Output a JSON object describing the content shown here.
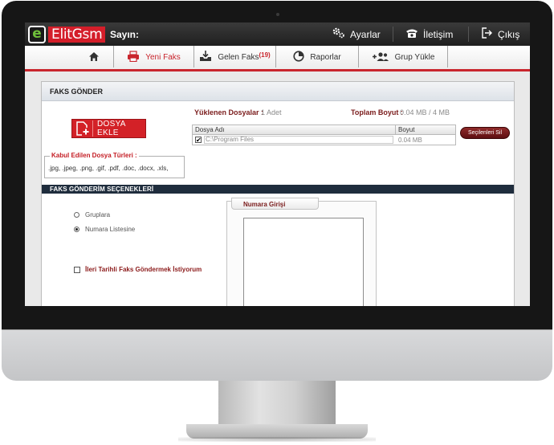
{
  "brand": {
    "logo_letter": "e",
    "logo_name": "ElitGsm",
    "greeting": "Sayın:"
  },
  "top_nav": [
    {
      "label": "Ayarlar",
      "icon": "gears-icon"
    },
    {
      "label": "İletişim",
      "icon": "phone-icon"
    },
    {
      "label": "Çıkış",
      "icon": "logout-icon"
    }
  ],
  "sub_nav": {
    "home_icon": "home-icon",
    "items": [
      {
        "label": "Yeni Faks",
        "icon": "printer-icon",
        "active": true
      },
      {
        "label": "Gelen Faks",
        "badge": "(19)",
        "icon": "inbox-download-icon"
      },
      {
        "label": "Raporlar",
        "icon": "pie-chart-icon"
      },
      {
        "label": "Grup Yükle",
        "icon": "group-add-icon"
      }
    ]
  },
  "panel": {
    "title": "FAKS GÖNDER",
    "uploaded_label": "Yüklenen Dosyalar :",
    "uploaded_value": "1 Adet",
    "total_size_label": "Toplam Boyut :",
    "total_size_value": "0.04 MB / 4 MB",
    "add_file_button": "DOSYA EKLE",
    "accepted_types_label": "Kabul Edilen Dosya Türleri :",
    "accepted_types": ".jpg, .jpeg, .png, .gif, .pdf, .doc, .docx, .xls,",
    "file_table": {
      "columns": [
        "Dosya Adı",
        "Boyut"
      ],
      "rows": [
        {
          "checked": true,
          "name": "C:\\Program Files",
          "size": "0.04 MB"
        }
      ]
    },
    "delete_selected_button": "Seçilenleri Sil",
    "options_title": "FAKS GÖNDERİM SEÇENEKLERİ",
    "send_options": [
      {
        "label": "Gruplara",
        "selected": false
      },
      {
        "label": "Numara Listesine",
        "selected": true
      }
    ],
    "schedule_checkbox": {
      "label": "İleri Tarihli Faks Göndermek İstiyorum",
      "checked": false
    },
    "number_entry_title": "Numara Girişi",
    "number_entry_value": ""
  },
  "colors": {
    "brand_red": "#d41e2a",
    "dark_bar": "#1f2d3d",
    "label_red": "#7a1b1b"
  }
}
